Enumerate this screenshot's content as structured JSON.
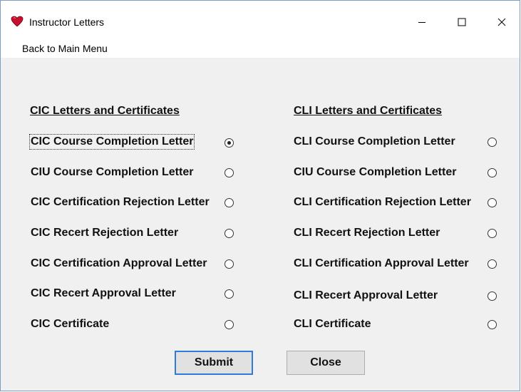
{
  "window": {
    "title": "Instructor Letters",
    "icon": "heart-icon",
    "controls": [
      "minimize-icon",
      "maximize-icon",
      "close-icon"
    ]
  },
  "menu": {
    "back": "Back to Main Menu"
  },
  "cic": {
    "heading": "CIC Letters and Certificates",
    "options": [
      {
        "label": "CIC Course Completion Letter",
        "checked": true
      },
      {
        "label": "CIU Course Completion Letter",
        "checked": false
      },
      {
        "label": "CIC Certification Rejection Letter",
        "checked": false
      },
      {
        "label": "CIC Recert Rejection Letter",
        "checked": false
      },
      {
        "label": "CIC Certification Approval Letter",
        "checked": false
      },
      {
        "label": "CIC Recert Approval Letter",
        "checked": false
      },
      {
        "label": "CIC Certificate",
        "checked": false
      }
    ]
  },
  "cli": {
    "heading": "CLI Letters and Certificates",
    "options": [
      {
        "label": "CLI Course Completion Letter",
        "checked": false
      },
      {
        "label": "CIU Course Completion Letter",
        "checked": false
      },
      {
        "label": "CLI Certification Rejection Letter",
        "checked": false
      },
      {
        "label": "CLI Recert Rejection Letter",
        "checked": false
      },
      {
        "label": "CLI Certification Approval Letter",
        "checked": false
      },
      {
        "label": "CLI Recert Approval Letter",
        "checked": false
      },
      {
        "label": "CLI Certificate",
        "checked": false
      }
    ]
  },
  "buttons": {
    "submit": "Submit",
    "close": "Close"
  },
  "colors": {
    "accent": "#2f7bd6",
    "icon_red": "#c8102e"
  }
}
